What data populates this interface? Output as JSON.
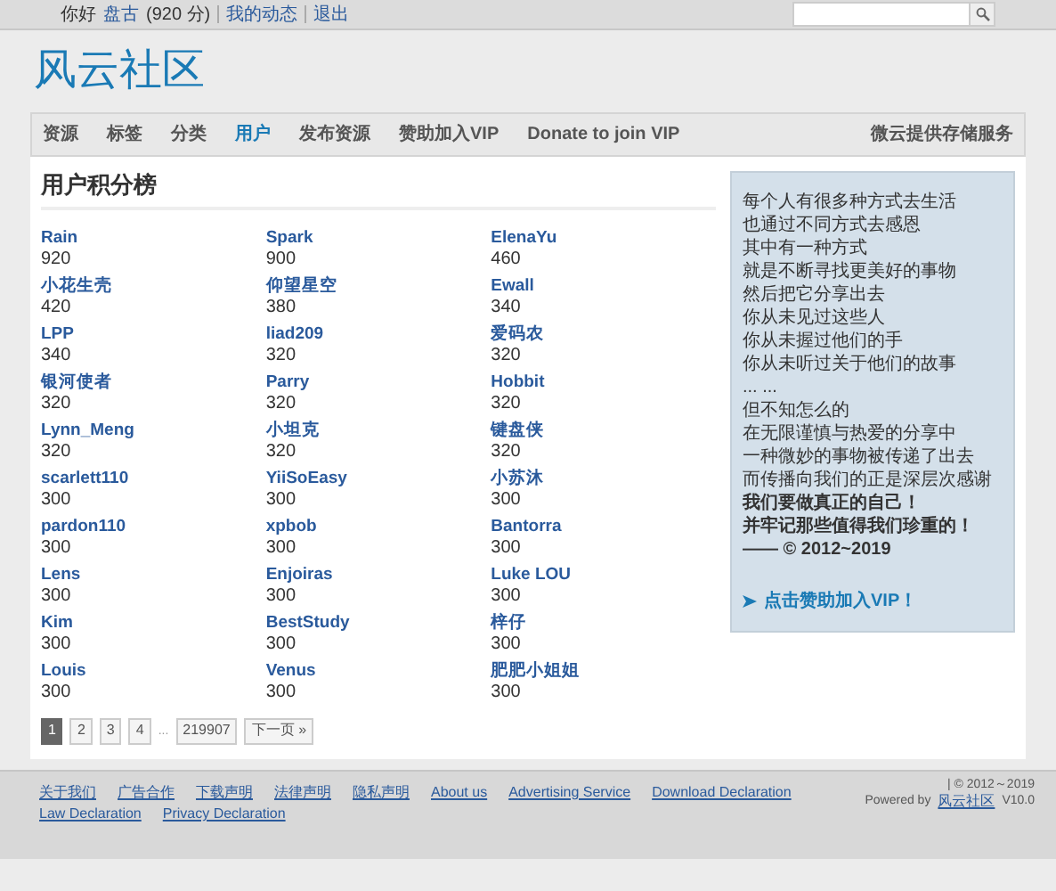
{
  "top_bar": {
    "greeting": "你好",
    "username": "盘古",
    "points": "(920 分)",
    "links": [
      "我的动态",
      "退出"
    ]
  },
  "site_title": "风云社区",
  "nav": {
    "items": [
      {
        "label": "资源",
        "selected": false
      },
      {
        "label": "标签",
        "selected": false
      },
      {
        "label": "分类",
        "selected": false
      },
      {
        "label": "用户",
        "selected": true
      },
      {
        "label": "发布资源",
        "selected": false
      },
      {
        "label": "赞助加入VIP",
        "selected": false
      },
      {
        "label": "Donate to join VIP",
        "selected": false
      }
    ],
    "right_link": "微云提供存储服务"
  },
  "ranking": {
    "title": "用户积分榜",
    "users": [
      {
        "name": "Rain",
        "score": "920"
      },
      {
        "name": "Spark",
        "score": "900"
      },
      {
        "name": "ElenaYu",
        "score": "460"
      },
      {
        "name": "小花生壳",
        "score": "420"
      },
      {
        "name": "仰望星空",
        "score": "380"
      },
      {
        "name": "Ewall",
        "score": "340"
      },
      {
        "name": "LPP",
        "score": "340"
      },
      {
        "name": "liad209",
        "score": "320"
      },
      {
        "name": "爱码农",
        "score": "320"
      },
      {
        "name": "银河使者",
        "score": "320"
      },
      {
        "name": "Parry",
        "score": "320"
      },
      {
        "name": "Hobbit",
        "score": "320"
      },
      {
        "name": "Lynn_Meng",
        "score": "320"
      },
      {
        "name": "小坦克",
        "score": "320"
      },
      {
        "name": "键盘侠",
        "score": "320"
      },
      {
        "name": "scarlett110",
        "score": "300"
      },
      {
        "name": "YiiSoEasy",
        "score": "300"
      },
      {
        "name": "小苏沐",
        "score": "300"
      },
      {
        "name": "pardon110",
        "score": "300"
      },
      {
        "name": "xpbob",
        "score": "300"
      },
      {
        "name": "Bantorra",
        "score": "300"
      },
      {
        "name": "Lens",
        "score": "300"
      },
      {
        "name": "Enjoiras",
        "score": "300"
      },
      {
        "name": "Luke LOU",
        "score": "300"
      },
      {
        "name": "Kim",
        "score": "300"
      },
      {
        "name": "BestStudy",
        "score": "300"
      },
      {
        "name": "梓仔",
        "score": "300"
      },
      {
        "name": "Louis",
        "score": "300"
      },
      {
        "name": "Venus",
        "score": "300"
      },
      {
        "name": "肥肥小姐姐",
        "score": "300"
      }
    ],
    "pagination": [
      {
        "kind": "page",
        "label": "1",
        "selected": true
      },
      {
        "kind": "page",
        "label": "2",
        "selected": false
      },
      {
        "kind": "page",
        "label": "3",
        "selected": false
      },
      {
        "kind": "page",
        "label": "4",
        "selected": false
      },
      {
        "kind": "ellipsis",
        "label": "...",
        "selected": false
      },
      {
        "kind": "page",
        "label": "219907",
        "selected": false
      },
      {
        "kind": "page",
        "label": "下一页 »",
        "selected": false
      }
    ]
  },
  "sidebar": {
    "lines": [
      {
        "text": "每个人有很多种方式去生活",
        "bold": false
      },
      {
        "text": "也通过不同方式去感恩",
        "bold": false
      },
      {
        "text": "其中有一种方式",
        "bold": false
      },
      {
        "text": "就是不断寻找更美好的事物",
        "bold": false
      },
      {
        "text": "然后把它分享出去",
        "bold": false
      },
      {
        "text": "你从未见过这些人",
        "bold": false
      },
      {
        "text": "你从未握过他们的手",
        "bold": false
      },
      {
        "text": "你从未听过关于他们的故事",
        "bold": false
      },
      {
        "text": "... ...",
        "bold": false
      },
      {
        "text": "但不知怎么的",
        "bold": false
      },
      {
        "text": "在无限谨慎与热爱的分享中",
        "bold": false
      },
      {
        "text": "一种微妙的事物被传递了出去",
        "bold": false
      },
      {
        "text": "而传播向我们的正是深层次感谢",
        "bold": false
      },
      {
        "text": "我们要做真正的自己！",
        "bold": true
      },
      {
        "text": "并牢记那些值得我们珍重的！",
        "bold": true
      },
      {
        "text": "—— © 2012~2019",
        "bold": true
      }
    ],
    "link": "点击赞助加入VIP！"
  },
  "footer": {
    "links": [
      "关于我们",
      "广告合作",
      "下载声明",
      "法律声明",
      "隐私声明",
      "About us",
      "Advertising Service",
      "Download Declaration",
      "Law Declaration",
      "Privacy Declaration"
    ],
    "copyright": "| © 2012～2019",
    "powered_by": "Powered by",
    "powered_link": "风云社区",
    "version": "V10.0"
  }
}
